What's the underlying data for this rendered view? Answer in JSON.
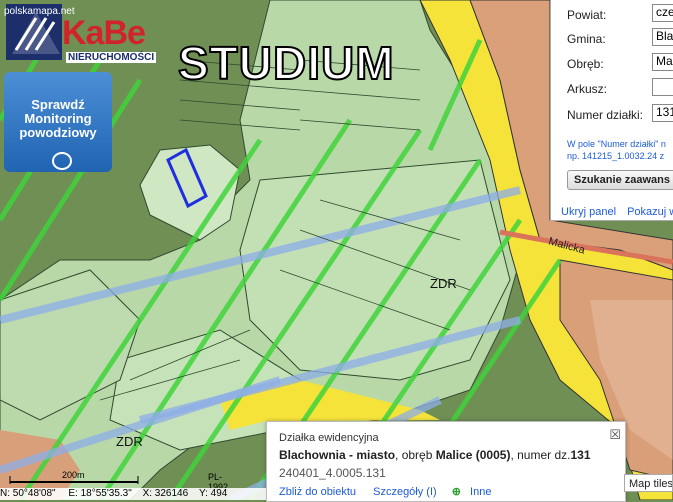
{
  "watermark": {
    "site": "polskamapa.net",
    "brand": "KaBe",
    "brand_sub": "NIERUCHOMOŚCI",
    "overlay_title": "STUDIUM"
  },
  "flood_button": {
    "line1": "Sprawdź",
    "line2": "Monitoring",
    "line3": "powodziowy"
  },
  "search_panel": {
    "fields": [
      {
        "label": "Powiat:",
        "value": "cze"
      },
      {
        "label": "Gmina:",
        "value": "Bla"
      },
      {
        "label": "Obręb:",
        "value": "Ma"
      },
      {
        "label": "Arkusz:",
        "value": ""
      },
      {
        "label": "Numer działki:",
        "value": "131"
      }
    ],
    "note_line1": "W pole \"Numer działki\" n",
    "note_line2": "np. 141215_1.0032.24 z",
    "search_label": "Szukanie zaawans",
    "hide_link": "Ukryj panel",
    "show_link": "Pokazuj w"
  },
  "map": {
    "road_label": "Malicka",
    "zone_labels": [
      "ZDR",
      "ZDR"
    ]
  },
  "popup": {
    "header": "Działka ewidencyjna",
    "town": "Blachownia - miasto",
    "mid1": ", obręb ",
    "precinct": "Malice (0005)",
    "mid2": ", numer dz.",
    "parcel": "131",
    "parcel_id": "240401_4.0005.131",
    "zoom_link": "Zbliż do obiektu",
    "details_link": "Szczegóły (I)",
    "other_link": "Inne"
  },
  "scale": {
    "distance": "200m",
    "crs": "PL-1992"
  },
  "status": {
    "lat": "N: 50°48'08\"",
    "lon": "E: 18°55'35.3\"",
    "x": "X: 326146",
    "y": "Y: 494"
  },
  "tiles_button": "Map tiles",
  "colors": {
    "forest": "#6f8f55",
    "light_green": "#c3e0b4",
    "yellow": "#f6e33a",
    "orange": "#d9a07a",
    "stripe_green": "#3fd43b",
    "stripe_blue": "#8eaee8",
    "link": "#1d5bd6"
  }
}
